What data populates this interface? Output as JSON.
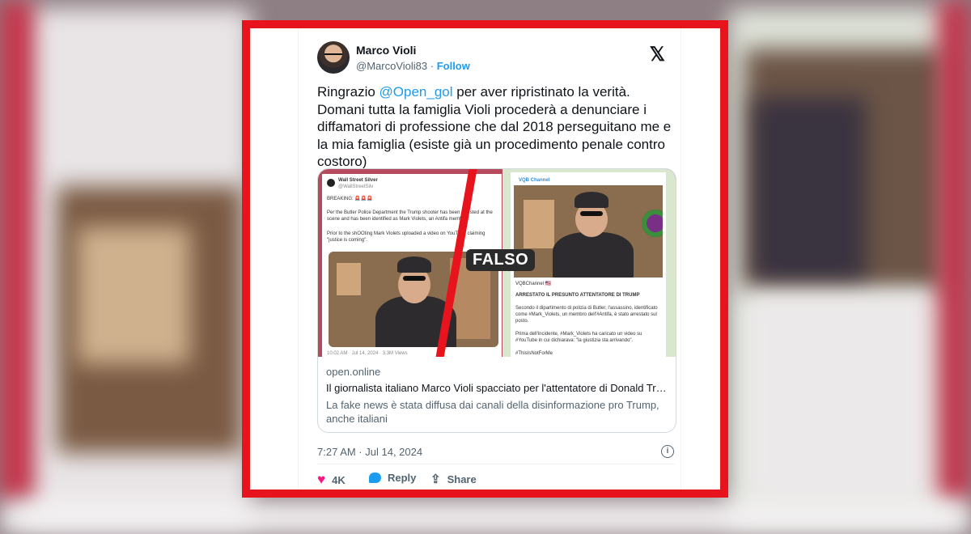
{
  "tweet": {
    "author_name": "Marco Violi",
    "handle": "@MarcoVioli83",
    "separator": "·",
    "follow_label": "Follow",
    "platform_logo": "𝕏",
    "text_before": "Ringrazio ",
    "mention": "@Open_gol",
    "text_after": " per aver ripristinato la verità. Domani tutta la famiglia Violi procederà a denunciare i diffamatori di professione che dal 2018 perseguitano me e la mia famiglia (esiste già un procedimento penale contro costoro)",
    "timestamp": "7:27 AM · Jul 14, 2024",
    "likes": "4K",
    "reply_label": "Reply",
    "share_label": "Share"
  },
  "link_card": {
    "domain": "open.online",
    "title": "Il giornalista italiano Marco Violi spacciato per l'attentatore di Donald Trump",
    "description": "La fake news è stata diffusa dai canali della disinformazione pro Trump, anche italiani",
    "preview": {
      "stamp": "FALSO",
      "left_post": {
        "account": "Wall Street Silver",
        "account_handle": "@WallStreetSilv",
        "breaking": "BREAKING: 🚨🚨🚨",
        "line1": "Per the Butler Police Department the Trump shooter has been arrested at the scene and has been identified as Mark Violets, an Antifa member.",
        "line2": "Prior to the shOOting Mark Violets uploaded a video on YouTube claiming \"justice is coming\".",
        "footer": "10:02 AM · Jul 14, 2024 · 3.3M Views"
      },
      "right_post": {
        "channel": "VQB Channel",
        "channel_short": "VQBChannel 🇺🇸",
        "headline": "ARRESTATO IL PRESUNTO ATTENTATORE DI TRUMP",
        "line1": "Secondo il dipartimento di polizia di Butler, l'assassino, identificato come #Mark_Violets, un membro dell'#Antifa, è stato arrestato sul posto.",
        "line2": "Prima dell'incidente, #Mark_Violets ha caricato un video su #YouTube in cui dichiarava: \"la giustizia sta arrivando\".",
        "hashtag": "#ThisIsNotForMe"
      }
    }
  },
  "colors": {
    "frame": "#e8141d",
    "link_blue": "#1d9bf0",
    "like_pink": "#f91880",
    "text_primary": "#0f1419",
    "text_secondary": "#536471"
  },
  "icons": [
    "avatar",
    "x-logo-icon",
    "heart-icon",
    "reply-icon",
    "share-icon",
    "info-icon"
  ]
}
